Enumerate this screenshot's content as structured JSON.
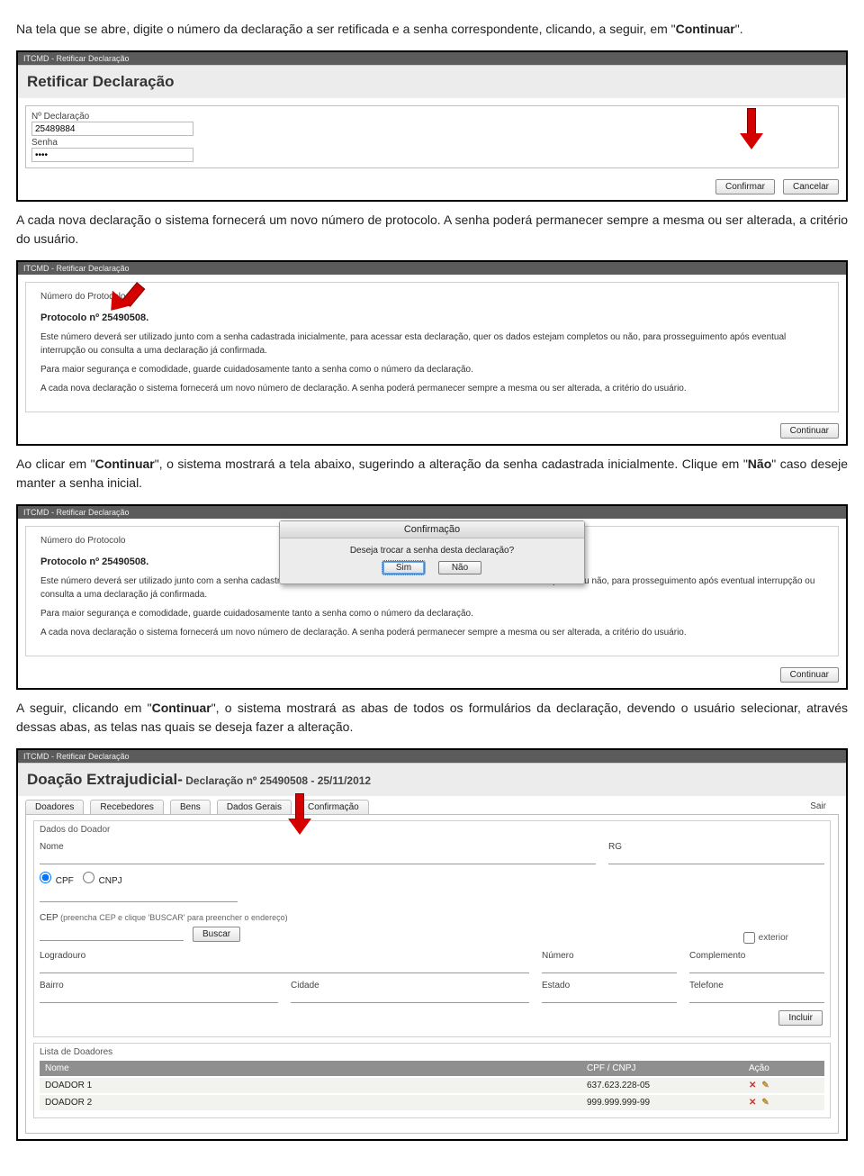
{
  "prose": {
    "p1a": "Na tela que se abre, digite o número da declaração a ser retificada e a senha correspondente, clicando, a seguir, em \"",
    "p1b": "Continuar",
    "p1c": "\".",
    "p2": "A cada nova declaração o sistema fornecerá um novo número de protocolo. A senha poderá permanecer sempre a mesma ou ser alterada, a critério do usuário.",
    "p3a": "Ao clicar em \"",
    "p3b": "Continuar",
    "p3c": "\", o sistema mostrará a tela abaixo, sugerindo a alteração da senha cadastrada inicialmente. Clique em \"",
    "p3d": "Não",
    "p3e": "\" caso deseje manter a senha inicial.",
    "p4a": "A seguir, clicando em \"",
    "p4b": "Continuar",
    "p4c": "\", o sistema mostrará as abas de todos os formulários da declaração, devendo o usuário selecionar, através dessas abas, as telas nas quais se deseja fazer a alteração."
  },
  "panel1": {
    "titlebar": "ITCMD - Retificar Declaração",
    "heading": "Retificar Declaração",
    "lbl_num": "Nº Declaração",
    "val_num": "25489884",
    "lbl_senha": "Senha",
    "val_senha": "••••",
    "btn_confirm": "Confirmar",
    "btn_cancel": "Cancelar"
  },
  "panel2": {
    "titlebar": "ITCMD - Retificar Declaração",
    "lbl_proto": "Número do Protocolo",
    "proto_head": "Protocolo nº 25490508.",
    "t1": "Este número deverá ser utilizado junto com a senha cadastrada inicialmente, para acessar esta declaração, quer os dados estejam completos ou não, para prosseguimento após eventual interrupção ou consulta a uma declaração já confirmada.",
    "t2": "Para maior segurança e comodidade, guarde cuidadosamente tanto a senha como o número da declaração.",
    "t3": "A cada nova declaração o sistema fornecerá um novo número de declaração. A senha poderá permanecer sempre a mesma ou ser alterada, a critério do usuário.",
    "btn_continue": "Continuar"
  },
  "panel3": {
    "titlebar": "ITCMD - Retificar Declaração",
    "lbl_proto": "Número do Protocolo",
    "proto_head": "Protocolo nº 25490508.",
    "t1a": "Este número deverá ser utilizado junto com a senha cadastrada inicialmente",
    "t1b": "npletos ou não, para prosseguimento após eventual interrupção ou consulta a uma declaração já confirmada.",
    "t2": "Para maior segurança e comodidade, guarde cuidadosamente tanto a senha como o número da declaração.",
    "t3": "A cada nova declaração o sistema fornecerá um novo número de declaração. A senha poderá permanecer sempre a mesma ou ser alterada, a critério do usuário.",
    "btn_continue": "Continuar",
    "dialog_title": "Confirmação",
    "dialog_msg": "Deseja trocar a senha desta declaração?",
    "dialog_yes": "Sim",
    "dialog_no": "Não"
  },
  "panel4": {
    "titlebar": "ITCMD - Retificar Declaração",
    "heading_main": "Doação Extrajudicial-",
    "heading_sub": " Declaração nº 25490508 - 25/11/2012",
    "tabs": [
      "Doadores",
      "Recebedores",
      "Bens",
      "Dados Gerais",
      "Confirmação"
    ],
    "tab_sair": "Sair",
    "grp_doador": "Dados do Doador",
    "lbl_nome": "Nome",
    "lbl_rg": "RG",
    "lbl_cpf": "CPF",
    "lbl_cnpj": "CNPJ",
    "lbl_cep": "CEP",
    "cep_note": "(preencha CEP e clique 'BUSCAR' para preencher o endereço)",
    "btn_buscar": "Buscar",
    "chk_exterior": "exterior",
    "lbl_logradouro": "Logradouro",
    "lbl_numero": "Número",
    "lbl_complemento": "Complemento",
    "lbl_bairro": "Bairro",
    "lbl_cidade": "Cidade",
    "lbl_estado": "Estado",
    "lbl_telefone": "Telefone",
    "btn_incluir": "Incluir",
    "grp_lista": "Lista de Doadores",
    "th_nome": "Nome",
    "th_cpf": "CPF / CNPJ",
    "th_acao": "Ação",
    "rows": [
      {
        "nome": "DOADOR 1",
        "doc": "637.623.228-05"
      },
      {
        "nome": "DOADOR 2",
        "doc": "999.999.999-99"
      }
    ]
  }
}
